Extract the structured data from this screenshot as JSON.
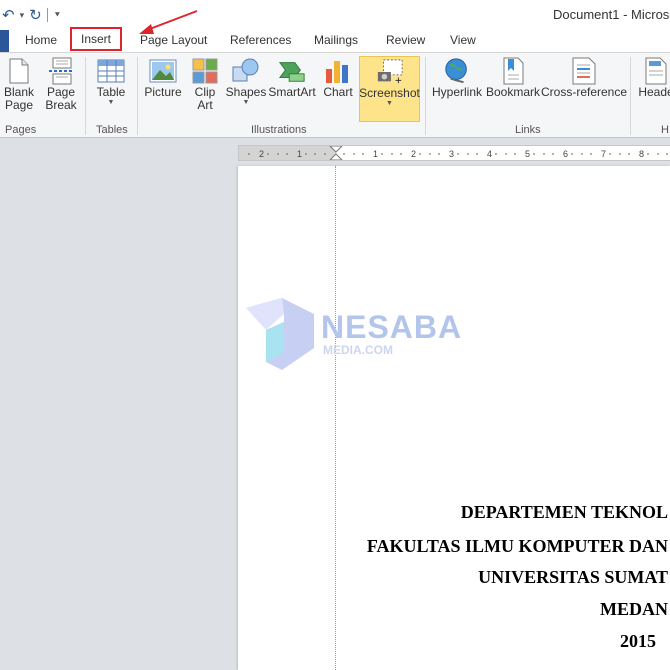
{
  "titlebar": {
    "doc_title": "Document1 - Microso",
    "qat": {
      "undo": "↶",
      "redo": "↻",
      "dropdown": "▾",
      "customize": "⯆"
    }
  },
  "tabs": {
    "home": "Home",
    "insert": "Insert",
    "page_layout": "Page Layout",
    "references": "References",
    "mailings": "Mailings",
    "review": "Review",
    "view": "View"
  },
  "ribbon": {
    "pages": {
      "label": "Pages",
      "blank_page": [
        "Blank",
        "Page"
      ],
      "page_break": [
        "Page",
        "Break"
      ]
    },
    "tables": {
      "label": "Tables",
      "table": "Table"
    },
    "illustrations": {
      "label": "Illustrations",
      "picture": "Picture",
      "clip_art": [
        "Clip",
        "Art"
      ],
      "shapes": "Shapes",
      "smartart": "SmartArt",
      "chart": "Chart",
      "screenshot": "Screenshot"
    },
    "links": {
      "label": "Links",
      "hyperlink": "Hyperlink",
      "bookmark": "Bookmark",
      "cross_reference": "Cross-reference"
    },
    "header_footer": {
      "label": "H",
      "header": "Heade"
    }
  },
  "ruler": {
    "numbers": [
      "2",
      "1",
      "1",
      "2",
      "3",
      "4",
      "5",
      "6",
      "7",
      "8"
    ]
  },
  "document": {
    "watermark": {
      "main": "NESABA",
      "sub": "MEDIA.COM"
    },
    "lines": [
      "DEPARTEMEN TEKNOL",
      "FAKULTAS ILMU KOMPUTER DAN",
      "UNIVERSITAS SUMAT",
      "MEDAN",
      "2015"
    ]
  },
  "colors": {
    "annotation_red": "#e0242c",
    "file_tab": "#2b579a",
    "screenshot_highlight": "#fde38a",
    "watermark": "#b4c5ec"
  }
}
